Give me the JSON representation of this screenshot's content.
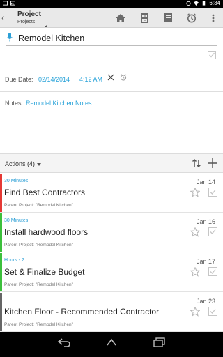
{
  "status": {
    "time": "6:34"
  },
  "header": {
    "title": "Project",
    "subtitle": "Projects"
  },
  "task": {
    "name": "Remodel Kitchen"
  },
  "due": {
    "label": "Due Date:",
    "date": "02/14/2014",
    "time": "4:12 AM"
  },
  "notes": {
    "label": "Notes:",
    "text": "Remodel Kitchen Notes ."
  },
  "actions": {
    "title": "Actions (4)",
    "items": [
      {
        "tag": "30 Minutes",
        "title": "Find Best Contractors",
        "parent": "Parent Project: \"Remodel Kitchen\"",
        "date": "Jan 14",
        "color": "#e53935"
      },
      {
        "tag": "30 Minutes",
        "title": "Install hardwood floors",
        "parent": "Parent Project: \"Remodel Kitchen\"",
        "date": "Jan 16",
        "color": "#3cc03c"
      },
      {
        "tag": "Hours - 2",
        "title": "Set & Finalize Budget",
        "parent": "Parent Project: \"Remodel Kitchen\"",
        "date": "Jan 17",
        "color": "#3cc03c"
      },
      {
        "tag": "",
        "title": "Kitchen Floor - Recommended Contractor",
        "parent": "Parent Project: \"Remodel Kitchen\"",
        "date": "Jan 23",
        "color": "#666666"
      }
    ]
  },
  "colors": {
    "accent": "#29a3d9",
    "header_bg": "#e9e9e9"
  }
}
